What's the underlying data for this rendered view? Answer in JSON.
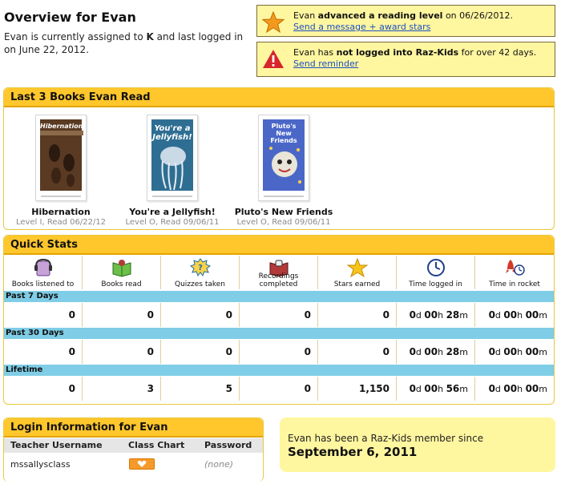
{
  "header": {
    "title": "Overview for Evan",
    "intro_pre": "Evan is currently assigned to ",
    "intro_level": "K",
    "intro_post": " and last logged in on June 22, 2012."
  },
  "alerts": [
    {
      "pre": "Evan ",
      "bold": "advanced a reading level",
      "post": " on 06/26/2012.",
      "link": "Send a message + award stars",
      "icon": "star-icon",
      "color": "#f39a1e"
    },
    {
      "pre": "Evan has ",
      "bold": "not logged into Raz-Kids",
      "post": " for over 42 days.",
      "link": "Send reminder",
      "icon": "warning-icon",
      "color": "#d6262b"
    }
  ],
  "books": {
    "title": "Last 3 Books Evan Read",
    "items": [
      {
        "title": "Hibernation",
        "meta": "Level I, Read 06/22/12",
        "cover_text": "Hibernation",
        "cover_color": "#5a3a22"
      },
      {
        "title": "You're a Jellyfish!",
        "meta": "Level O, Read 09/06/11",
        "cover_text": "You're a Jellyfish!",
        "cover_color": "#2f6e93"
      },
      {
        "title": "Pluto's New Friends",
        "meta": "Level O, Read 09/06/11",
        "cover_text": "Pluto's New Friends",
        "cover_color": "#4a67c8"
      }
    ]
  },
  "stats": {
    "title": "Quick Stats",
    "columns": [
      "Books listened to",
      "Books read",
      "Quizzes taken",
      "Recordings completed",
      "Stars earned",
      "Time logged in",
      "Time in rocket"
    ],
    "column_icons": [
      "listen-icon",
      "book-icon",
      "quiz-icon",
      "recording-icon",
      "star-icon",
      "clock-icon",
      "rocket-icon"
    ],
    "rows": [
      {
        "label": "Past 7 Days",
        "values": [
          "0",
          "0",
          "0",
          "0",
          "0"
        ],
        "time1": [
          "0",
          "d ",
          "00",
          "h ",
          "28",
          "m"
        ],
        "time2": [
          "0",
          "d ",
          "00",
          "h ",
          "00",
          "m"
        ]
      },
      {
        "label": "Past 30 Days",
        "values": [
          "0",
          "0",
          "0",
          "0",
          "0"
        ],
        "time1": [
          "0",
          "d ",
          "00",
          "h ",
          "28",
          "m"
        ],
        "time2": [
          "0",
          "d ",
          "00",
          "h ",
          "00",
          "m"
        ]
      },
      {
        "label": "Lifetime",
        "values": [
          "0",
          "3",
          "5",
          "0",
          "1,150"
        ],
        "time1": [
          "0",
          "d ",
          "00",
          "h ",
          "56",
          "m"
        ],
        "time2": [
          "0",
          "d ",
          "00",
          "h ",
          "00",
          "m"
        ]
      }
    ]
  },
  "login": {
    "title": "Login Information for Evan",
    "col_username": "Teacher Username",
    "col_chart": "Class Chart",
    "col_password": "Password",
    "username": "mssallysclass",
    "password": "(none)"
  },
  "member": {
    "line1": "Evan has been a Raz-Kids member since",
    "date": "September 6, 2011"
  },
  "colors": {
    "accent": "#ffc72c",
    "band": "#7fcde6",
    "link": "#1a4fc2",
    "alert_bg": "#fff6a0"
  }
}
